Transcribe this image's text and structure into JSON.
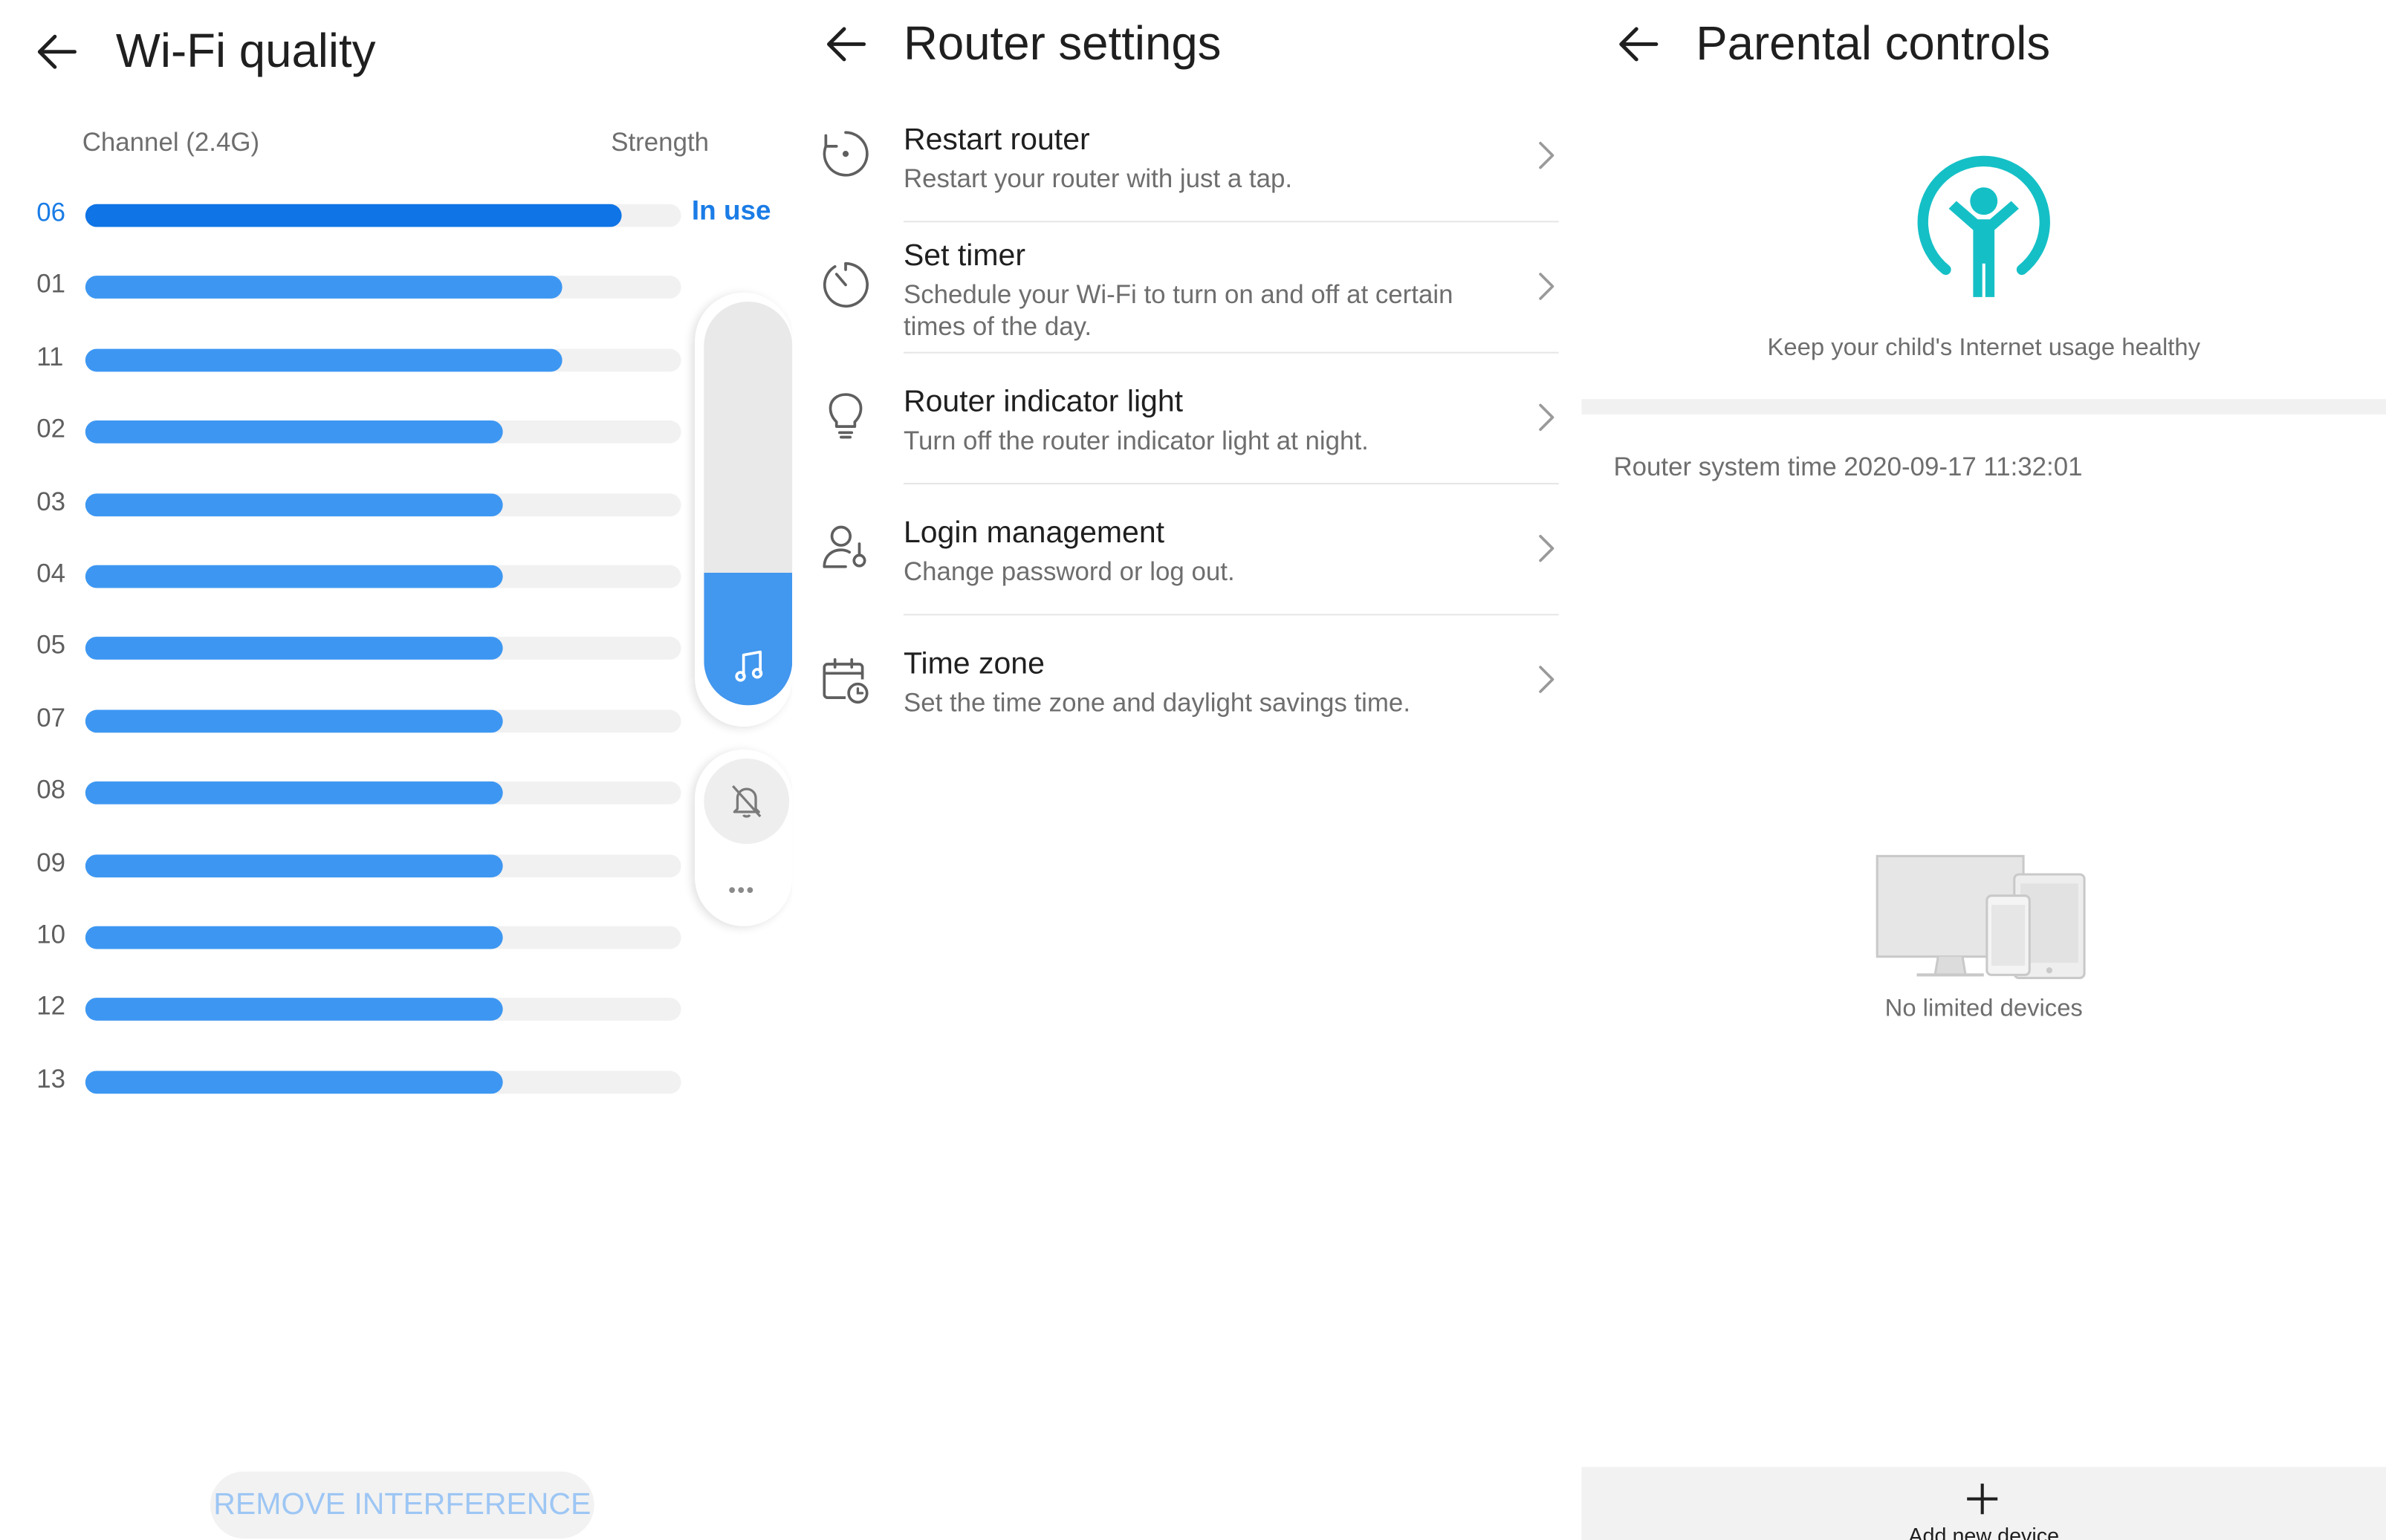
{
  "wifi": {
    "title": "Wi-Fi quality",
    "channel_header": "Channel (2.4G)",
    "strength_header": "Strength",
    "in_use_label": "In use",
    "channels": [
      {
        "num": "06",
        "strength": 0.9,
        "active": true
      },
      {
        "num": "01",
        "strength": 0.8
      },
      {
        "num": "11",
        "strength": 0.8
      },
      {
        "num": "02",
        "strength": 0.7
      },
      {
        "num": "03",
        "strength": 0.7
      },
      {
        "num": "04",
        "strength": 0.7
      },
      {
        "num": "05",
        "strength": 0.7
      },
      {
        "num": "07",
        "strength": 0.7
      },
      {
        "num": "08",
        "strength": 0.7
      },
      {
        "num": "09",
        "strength": 0.7
      },
      {
        "num": "10",
        "strength": 0.7
      },
      {
        "num": "12",
        "strength": 0.7
      },
      {
        "num": "13",
        "strength": 0.7
      }
    ],
    "volume_level": 0.33,
    "remove_button": "REMOVE INTERFERENCE",
    "more_dots": "•••"
  },
  "router": {
    "title": "Router settings",
    "items": [
      {
        "icon": "restart-icon",
        "title": "Restart router",
        "subtitle": "Restart your router with just a tap."
      },
      {
        "icon": "timer-icon",
        "title": "Set timer",
        "subtitle": "Schedule your Wi-Fi to turn on and off at certain times of the day."
      },
      {
        "icon": "lightbulb-icon",
        "title": "Router indicator light",
        "subtitle": "Turn off the router indicator light at night."
      },
      {
        "icon": "user-settings-icon",
        "title": "Login management",
        "subtitle": "Change password or log out."
      },
      {
        "icon": "calendar-clock-icon",
        "title": "Time zone",
        "subtitle": "Set the time zone and daylight savings time."
      }
    ]
  },
  "parental": {
    "title": "Parental controls",
    "tagline": "Keep your child's Internet usage healthy",
    "system_time": "Router system time 2020-09-17 11:32:01",
    "empty_label": "No limited devices",
    "add_label": "Add new device"
  },
  "colors": {
    "accent": "#1a7ce6",
    "bar": "#3d97f2",
    "teal": "#14c0c6"
  }
}
